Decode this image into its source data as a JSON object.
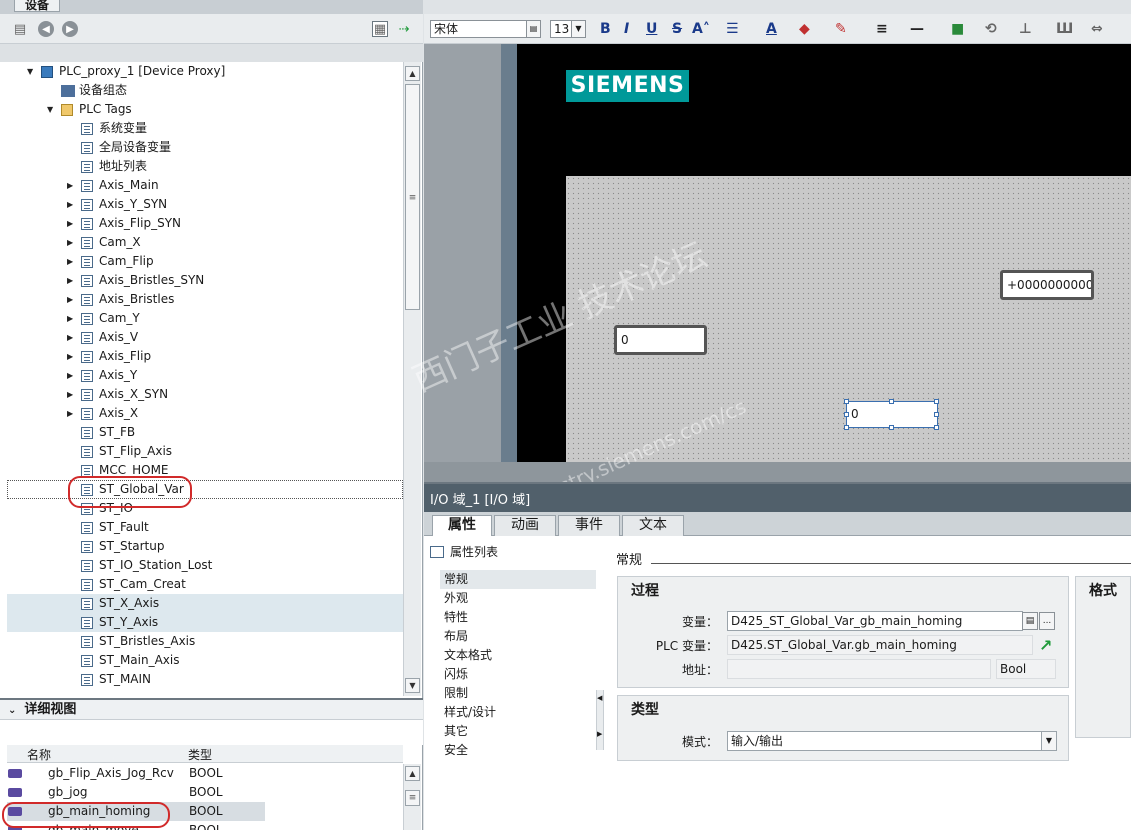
{
  "left": {
    "panel_tab": "设备",
    "tree": [
      {
        "label": "PLC_proxy_1 [Device Proxy]",
        "indent": 0,
        "arrow": "down",
        "icon": "device"
      },
      {
        "label": "设备组态",
        "indent": 1,
        "arrow": "",
        "icon": "cfg"
      },
      {
        "label": "PLC Tags",
        "indent": 1,
        "arrow": "down",
        "icon": "folder"
      },
      {
        "label": "系统变量",
        "indent": 2,
        "arrow": "",
        "icon": "table"
      },
      {
        "label": "全局设备变量",
        "indent": 2,
        "arrow": "",
        "icon": "table"
      },
      {
        "label": "地址列表",
        "indent": 2,
        "arrow": "",
        "icon": "table"
      },
      {
        "label": "Axis_Main",
        "indent": 2,
        "arrow": "right",
        "icon": "table"
      },
      {
        "label": "Axis_Y_SYN",
        "indent": 2,
        "arrow": "right",
        "icon": "table"
      },
      {
        "label": "Axis_Flip_SYN",
        "indent": 2,
        "arrow": "right",
        "icon": "table"
      },
      {
        "label": "Cam_X",
        "indent": 2,
        "arrow": "right",
        "icon": "table"
      },
      {
        "label": "Cam_Flip",
        "indent": 2,
        "arrow": "right",
        "icon": "table"
      },
      {
        "label": "Axis_Bristles_SYN",
        "indent": 2,
        "arrow": "right",
        "icon": "table"
      },
      {
        "label": "Axis_Bristles",
        "indent": 2,
        "arrow": "right",
        "icon": "table"
      },
      {
        "label": "Cam_Y",
        "indent": 2,
        "arrow": "right",
        "icon": "table"
      },
      {
        "label": "Axis_V",
        "indent": 2,
        "arrow": "right",
        "icon": "table"
      },
      {
        "label": "Axis_Flip",
        "indent": 2,
        "arrow": "right",
        "icon": "table"
      },
      {
        "label": "Axis_Y",
        "indent": 2,
        "arrow": "right",
        "icon": "table"
      },
      {
        "label": "Axis_X_SYN",
        "indent": 2,
        "arrow": "right",
        "icon": "table"
      },
      {
        "label": "Axis_X",
        "indent": 2,
        "arrow": "right",
        "icon": "table"
      },
      {
        "label": "ST_FB",
        "indent": 2,
        "arrow": "",
        "icon": "table"
      },
      {
        "label": "ST_Flip_Axis",
        "indent": 2,
        "arrow": "",
        "icon": "table"
      },
      {
        "label": "MCC_HOME",
        "indent": 2,
        "arrow": "",
        "icon": "table"
      },
      {
        "label": "ST_Global_Var",
        "indent": 2,
        "arrow": "",
        "icon": "table",
        "focus": true
      },
      {
        "label": "ST_IO",
        "indent": 2,
        "arrow": "",
        "icon": "table"
      },
      {
        "label": "ST_Fault",
        "indent": 2,
        "arrow": "",
        "icon": "table"
      },
      {
        "label": "ST_Startup",
        "indent": 2,
        "arrow": "",
        "icon": "table"
      },
      {
        "label": "ST_IO_Station_Lost",
        "indent": 2,
        "arrow": "",
        "icon": "table"
      },
      {
        "label": "ST_Cam_Creat",
        "indent": 2,
        "arrow": "",
        "icon": "table"
      },
      {
        "label": "ST_X_Axis",
        "indent": 2,
        "arrow": "",
        "icon": "table",
        "selected": true
      },
      {
        "label": "ST_Y_Axis",
        "indent": 2,
        "arrow": "",
        "icon": "table",
        "selected": true
      },
      {
        "label": "ST_Bristles_Axis",
        "indent": 2,
        "arrow": "",
        "icon": "table"
      },
      {
        "label": "ST_Main_Axis",
        "indent": 2,
        "arrow": "",
        "icon": "table"
      },
      {
        "label": "ST_MAIN",
        "indent": 2,
        "arrow": "",
        "icon": "table"
      }
    ],
    "detail": {
      "title": "详细视图",
      "col_name": "名称",
      "col_type": "类型",
      "rows": [
        {
          "name": "gb_Flip_Axis_Jog_Rcv",
          "type": "BOOL"
        },
        {
          "name": "gb_jog",
          "type": "BOOL"
        },
        {
          "name": "gb_main_homing",
          "type": "BOOL",
          "selected": true
        },
        {
          "name": "gb_main_move",
          "type": "BOOL"
        }
      ]
    }
  },
  "format_toolbar": {
    "font": "宋体",
    "size": "13",
    "bold": "B",
    "italic": "I",
    "underline": "U",
    "strike": "S",
    "fontsize_glyph": "A˄",
    "color_glyph": "A"
  },
  "canvas": {
    "logo": "SIEMENS",
    "field_big": "+0000000000",
    "field_left": "0",
    "field_selected": "0",
    "watermark_cn": "西门子工业  技术论坛",
    "watermark_url": "support.industry.siemens.com/cs"
  },
  "inspector": {
    "title": "I/O 域_1 [I/O 域]",
    "tabs": [
      "属性",
      "动画",
      "事件",
      "文本"
    ],
    "prop_list_label": "属性列表",
    "nav": [
      "常规",
      "外观",
      "特性",
      "布局",
      "文本格式",
      "闪烁",
      "限制",
      "样式/设计",
      "其它",
      "安全"
    ],
    "section_title": "常规",
    "process": {
      "title": "过程",
      "var_label": "变量：",
      "var_value": "D425_ST_Global_Var_gb_main_homing",
      "plc_label": "PLC 变量：",
      "plc_value": "D425.ST_Global_Var.gb_main_homing",
      "addr_label": "地址：",
      "addr_value": "",
      "addr_type": "Bool",
      "browse_label": "..."
    },
    "type": {
      "title": "类型",
      "mode_label": "模式：",
      "mode_value": "输入/输出"
    },
    "format_title": "格式"
  }
}
